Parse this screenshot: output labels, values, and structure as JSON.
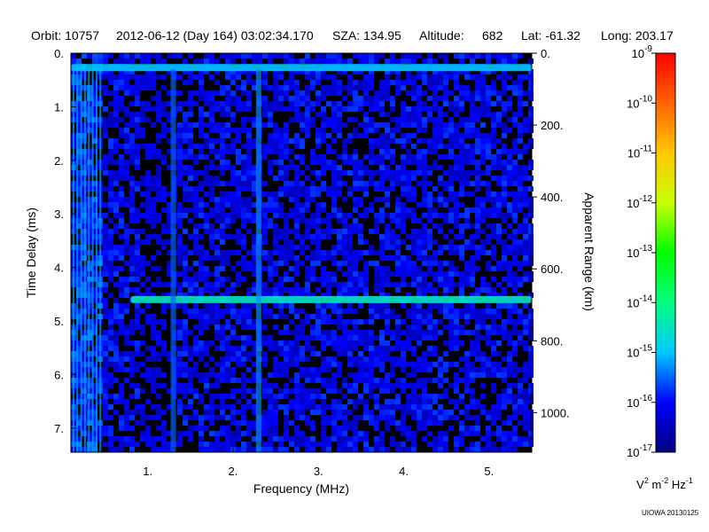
{
  "header": {
    "orbit": "Orbit: 10757",
    "datetime": "2012-06-12 (Day 164) 03:02:34.170",
    "sza": "SZA: 134.95",
    "altitude_label": "Altitude:",
    "altitude_value": "682",
    "lat": "Lat: -61.32",
    "long": "Long: 203.17"
  },
  "credit": "UIOWA 20130125",
  "chart_data": {
    "type": "heatmap",
    "title": "",
    "xlabel": "Frequency (MHz)",
    "ylabel": "Time Delay (ms)",
    "y2label": "Apparent Range (km)",
    "xlim": [
      0.1,
      5.5
    ],
    "ylim": [
      0,
      7.45
    ],
    "y2lim": [
      0,
      1110
    ],
    "y_inverted": true,
    "x_ticks": [
      {
        "value": 1,
        "label": "1."
      },
      {
        "value": 2,
        "label": "2."
      },
      {
        "value": 3,
        "label": "3."
      },
      {
        "value": 4,
        "label": "4."
      },
      {
        "value": 5,
        "label": "5."
      }
    ],
    "y_ticks": [
      {
        "value": 0,
        "label": "0."
      },
      {
        "value": 1,
        "label": "1."
      },
      {
        "value": 2,
        "label": "2."
      },
      {
        "value": 3,
        "label": "3."
      },
      {
        "value": 4,
        "label": "4."
      },
      {
        "value": 5,
        "label": "5."
      },
      {
        "value": 6,
        "label": "6."
      },
      {
        "value": 7,
        "label": "7."
      }
    ],
    "y2_ticks": [
      {
        "value": 0,
        "label": "0."
      },
      {
        "value": 200,
        "label": "200."
      },
      {
        "value": 400,
        "label": "400."
      },
      {
        "value": 600,
        "label": "600."
      },
      {
        "value": 800,
        "label": "800."
      },
      {
        "value": 1000,
        "label": "1000."
      }
    ],
    "colorbar": {
      "scale": "log",
      "range_exponent": [
        -17,
        -9
      ],
      "units_base": "V",
      "units_tail": "m",
      "units_end": "Hz",
      "units_exp_a": "2",
      "units_exp_b": "-2",
      "units_exp_c": "-1",
      "ticks": [
        {
          "exp": -9,
          "base": "10",
          "sup": "-9"
        },
        {
          "exp": -10,
          "base": "10",
          "sup": "-10"
        },
        {
          "exp": -11,
          "base": "10",
          "sup": "-11"
        },
        {
          "exp": -12,
          "base": "10",
          "sup": "-12"
        },
        {
          "exp": -13,
          "base": "10",
          "sup": "-13"
        },
        {
          "exp": -14,
          "base": "10",
          "sup": "-14"
        },
        {
          "exp": -15,
          "base": "10",
          "sup": "-15"
        },
        {
          "exp": -16,
          "base": "10",
          "sup": "-16"
        },
        {
          "exp": -17,
          "base": "10",
          "sup": "-17"
        }
      ],
      "colors": [
        "#000080",
        "#0000ff",
        "#00c8ff",
        "#00ff80",
        "#00ff00",
        "#c8ff00",
        "#ffc800",
        "#ff6400",
        "#ff0000"
      ]
    },
    "features": [
      {
        "name": "ground echo",
        "time_delay_ms": 4.6,
        "freq_range": [
          0.8,
          5.5
        ],
        "level_exp": -14.5
      },
      {
        "name": "top band",
        "time_delay_ms": 0.27,
        "freq_range": [
          0.1,
          5.5
        ],
        "level_exp": -15.0
      },
      {
        "name": "vertical line",
        "freq_mhz": 2.3,
        "level_exp": -15.3
      },
      {
        "name": "vertical line",
        "freq_mhz": 1.3,
        "level_exp": -15.5
      }
    ],
    "background_level_exp": -16.2
  }
}
